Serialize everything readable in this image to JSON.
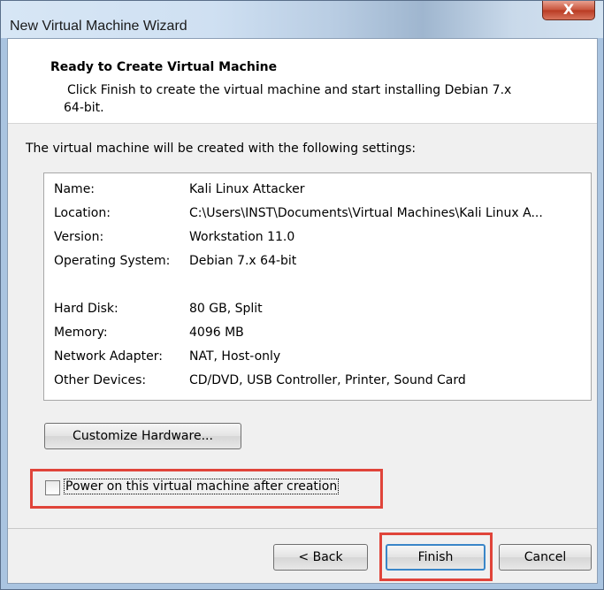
{
  "window": {
    "title": "New Virtual Machine Wizard",
    "close_glyph": "X"
  },
  "header": {
    "title": "Ready to Create Virtual Machine",
    "desc_line1": "Click Finish to create the virtual machine and start installing Debian 7.x",
    "desc_line2": "64-bit."
  },
  "intro": "The virtual machine will be created with the following settings:",
  "settings": [
    {
      "key": "Name:",
      "value": "Kali Linux Attacker"
    },
    {
      "key": "Location:",
      "value": "C:\\Users\\INST\\Documents\\Virtual Machines\\Kali Linux A..."
    },
    {
      "key": "Version:",
      "value": "Workstation 11.0"
    },
    {
      "key": "Operating System:",
      "value": "Debian 7.x 64-bit"
    },
    {
      "key": "Hard Disk:",
      "value": "80 GB, Split"
    },
    {
      "key": "Memory:",
      "value": "4096 MB"
    },
    {
      "key": "Network Adapter:",
      "value": "NAT, Host-only"
    },
    {
      "key": "Other Devices:",
      "value": "CD/DVD, USB Controller, Printer, Sound Card"
    }
  ],
  "buttons": {
    "customize": "Customize Hardware...",
    "back": "< Back",
    "finish": "Finish",
    "cancel": "Cancel"
  },
  "power_on": {
    "label": "Power on this virtual machine after creation",
    "checked": false
  },
  "colors": {
    "highlight": "#e0443a",
    "close_button": "#c7523a",
    "default_button_border": "#3a86c8"
  }
}
